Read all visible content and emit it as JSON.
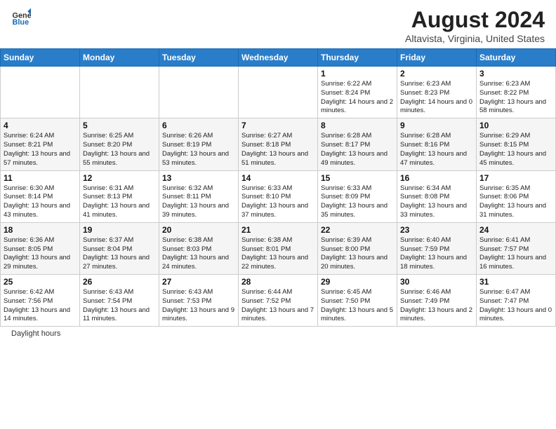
{
  "header": {
    "logo_line1": "General",
    "logo_line2": "Blue",
    "title": "August 2024",
    "subtitle": "Altavista, Virginia, United States"
  },
  "days_of_week": [
    "Sunday",
    "Monday",
    "Tuesday",
    "Wednesday",
    "Thursday",
    "Friday",
    "Saturday"
  ],
  "weeks": [
    [
      {
        "day": "",
        "detail": ""
      },
      {
        "day": "",
        "detail": ""
      },
      {
        "day": "",
        "detail": ""
      },
      {
        "day": "",
        "detail": ""
      },
      {
        "day": "1",
        "detail": "Sunrise: 6:22 AM\nSunset: 8:24 PM\nDaylight: 14 hours\nand 2 minutes."
      },
      {
        "day": "2",
        "detail": "Sunrise: 6:23 AM\nSunset: 8:23 PM\nDaylight: 14 hours\nand 0 minutes."
      },
      {
        "day": "3",
        "detail": "Sunrise: 6:23 AM\nSunset: 8:22 PM\nDaylight: 13 hours\nand 58 minutes."
      }
    ],
    [
      {
        "day": "4",
        "detail": "Sunrise: 6:24 AM\nSunset: 8:21 PM\nDaylight: 13 hours\nand 57 minutes."
      },
      {
        "day": "5",
        "detail": "Sunrise: 6:25 AM\nSunset: 8:20 PM\nDaylight: 13 hours\nand 55 minutes."
      },
      {
        "day": "6",
        "detail": "Sunrise: 6:26 AM\nSunset: 8:19 PM\nDaylight: 13 hours\nand 53 minutes."
      },
      {
        "day": "7",
        "detail": "Sunrise: 6:27 AM\nSunset: 8:18 PM\nDaylight: 13 hours\nand 51 minutes."
      },
      {
        "day": "8",
        "detail": "Sunrise: 6:28 AM\nSunset: 8:17 PM\nDaylight: 13 hours\nand 49 minutes."
      },
      {
        "day": "9",
        "detail": "Sunrise: 6:28 AM\nSunset: 8:16 PM\nDaylight: 13 hours\nand 47 minutes."
      },
      {
        "day": "10",
        "detail": "Sunrise: 6:29 AM\nSunset: 8:15 PM\nDaylight: 13 hours\nand 45 minutes."
      }
    ],
    [
      {
        "day": "11",
        "detail": "Sunrise: 6:30 AM\nSunset: 8:14 PM\nDaylight: 13 hours\nand 43 minutes."
      },
      {
        "day": "12",
        "detail": "Sunrise: 6:31 AM\nSunset: 8:13 PM\nDaylight: 13 hours\nand 41 minutes."
      },
      {
        "day": "13",
        "detail": "Sunrise: 6:32 AM\nSunset: 8:11 PM\nDaylight: 13 hours\nand 39 minutes."
      },
      {
        "day": "14",
        "detail": "Sunrise: 6:33 AM\nSunset: 8:10 PM\nDaylight: 13 hours\nand 37 minutes."
      },
      {
        "day": "15",
        "detail": "Sunrise: 6:33 AM\nSunset: 8:09 PM\nDaylight: 13 hours\nand 35 minutes."
      },
      {
        "day": "16",
        "detail": "Sunrise: 6:34 AM\nSunset: 8:08 PM\nDaylight: 13 hours\nand 33 minutes."
      },
      {
        "day": "17",
        "detail": "Sunrise: 6:35 AM\nSunset: 8:06 PM\nDaylight: 13 hours\nand 31 minutes."
      }
    ],
    [
      {
        "day": "18",
        "detail": "Sunrise: 6:36 AM\nSunset: 8:05 PM\nDaylight: 13 hours\nand 29 minutes."
      },
      {
        "day": "19",
        "detail": "Sunrise: 6:37 AM\nSunset: 8:04 PM\nDaylight: 13 hours\nand 27 minutes."
      },
      {
        "day": "20",
        "detail": "Sunrise: 6:38 AM\nSunset: 8:03 PM\nDaylight: 13 hours\nand 24 minutes."
      },
      {
        "day": "21",
        "detail": "Sunrise: 6:38 AM\nSunset: 8:01 PM\nDaylight: 13 hours\nand 22 minutes."
      },
      {
        "day": "22",
        "detail": "Sunrise: 6:39 AM\nSunset: 8:00 PM\nDaylight: 13 hours\nand 20 minutes."
      },
      {
        "day": "23",
        "detail": "Sunrise: 6:40 AM\nSunset: 7:59 PM\nDaylight: 13 hours\nand 18 minutes."
      },
      {
        "day": "24",
        "detail": "Sunrise: 6:41 AM\nSunset: 7:57 PM\nDaylight: 13 hours\nand 16 minutes."
      }
    ],
    [
      {
        "day": "25",
        "detail": "Sunrise: 6:42 AM\nSunset: 7:56 PM\nDaylight: 13 hours\nand 14 minutes."
      },
      {
        "day": "26",
        "detail": "Sunrise: 6:43 AM\nSunset: 7:54 PM\nDaylight: 13 hours\nand 11 minutes."
      },
      {
        "day": "27",
        "detail": "Sunrise: 6:43 AM\nSunset: 7:53 PM\nDaylight: 13 hours\nand 9 minutes."
      },
      {
        "day": "28",
        "detail": "Sunrise: 6:44 AM\nSunset: 7:52 PM\nDaylight: 13 hours\nand 7 minutes."
      },
      {
        "day": "29",
        "detail": "Sunrise: 6:45 AM\nSunset: 7:50 PM\nDaylight: 13 hours\nand 5 minutes."
      },
      {
        "day": "30",
        "detail": "Sunrise: 6:46 AM\nSunset: 7:49 PM\nDaylight: 13 hours\nand 2 minutes."
      },
      {
        "day": "31",
        "detail": "Sunrise: 6:47 AM\nSunset: 7:47 PM\nDaylight: 13 hours\nand 0 minutes."
      }
    ]
  ],
  "footer": {
    "label": "Daylight hours"
  }
}
